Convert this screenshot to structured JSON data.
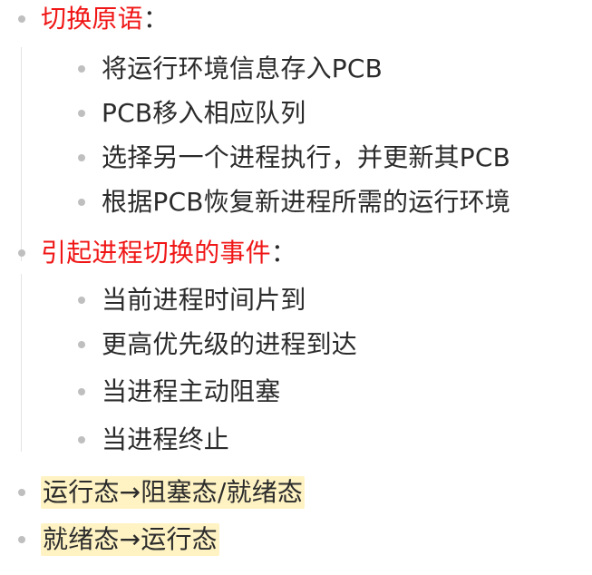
{
  "outline": {
    "section1": {
      "title": "切换原语",
      "colon": "：",
      "items": [
        "将运行环境信息存入PCB",
        "PCB移入相应队列",
        "选择另一个进程执行，并更新其PCB",
        "根据PCB恢复新进程所需的运行环境"
      ]
    },
    "section2": {
      "title": "引起进程切换的事件",
      "colon": "：",
      "items": [
        "当前进程时间片到",
        "更高优先级的进程到达",
        "当进程主动阻塞",
        "当进程终止"
      ]
    },
    "item3": "运行态→阻塞态/就绪态",
    "item4": "就绪态→运行态"
  },
  "colors": {
    "heading_red": "#f01616",
    "highlight": "#fff3c4",
    "bullet": "#bfbfbf",
    "guide_line": "#e3e3e3"
  }
}
